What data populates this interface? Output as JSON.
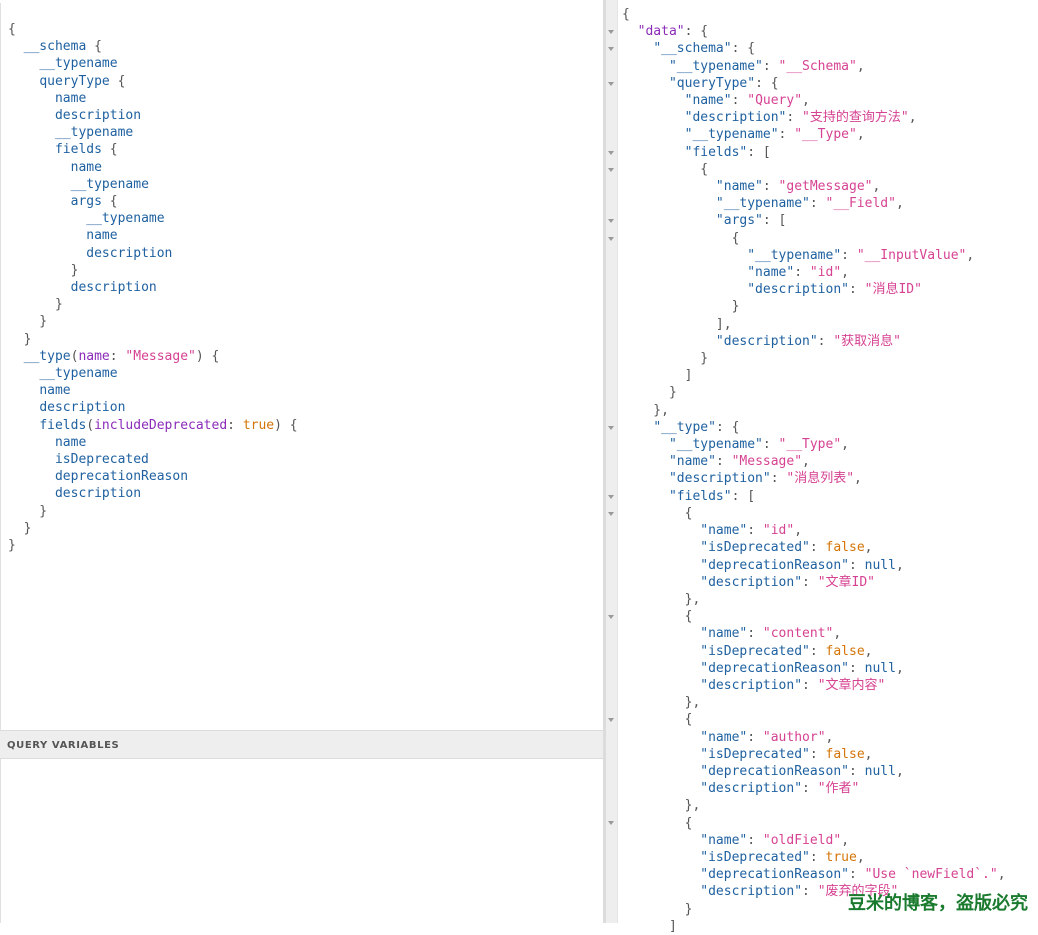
{
  "query": {
    "lines": [
      [
        [
          "p",
          "{"
        ]
      ],
      [
        [
          "p",
          "  "
        ],
        [
          "k",
          "__schema"
        ],
        [
          "p",
          " {"
        ]
      ],
      [
        [
          "p",
          "    "
        ],
        [
          "k",
          "__typename"
        ]
      ],
      [
        [
          "p",
          "    "
        ],
        [
          "k",
          "queryType"
        ],
        [
          "p",
          " {"
        ]
      ],
      [
        [
          "p",
          "      "
        ],
        [
          "k",
          "name"
        ]
      ],
      [
        [
          "p",
          "      "
        ],
        [
          "k",
          "description"
        ]
      ],
      [
        [
          "p",
          "      "
        ],
        [
          "k",
          "__typename"
        ]
      ],
      [
        [
          "p",
          "      "
        ],
        [
          "k",
          "fields"
        ],
        [
          "p",
          " {"
        ]
      ],
      [
        [
          "p",
          "        "
        ],
        [
          "k",
          "name"
        ]
      ],
      [
        [
          "p",
          "        "
        ],
        [
          "k",
          "__typename"
        ]
      ],
      [
        [
          "p",
          "        "
        ],
        [
          "k",
          "args"
        ],
        [
          "p",
          " {"
        ]
      ],
      [
        [
          "p",
          "          "
        ],
        [
          "k",
          "__typename"
        ]
      ],
      [
        [
          "p",
          "          "
        ],
        [
          "k",
          "name"
        ]
      ],
      [
        [
          "p",
          "          "
        ],
        [
          "k",
          "description"
        ]
      ],
      [
        [
          "p",
          "        }"
        ]
      ],
      [
        [
          "p",
          "        "
        ],
        [
          "k",
          "description"
        ]
      ],
      [
        [
          "p",
          "      }"
        ]
      ],
      [
        [
          "p",
          "    }"
        ]
      ],
      [
        [
          "p",
          "  }"
        ]
      ],
      [
        [
          "p",
          "  "
        ],
        [
          "k",
          "__type"
        ],
        [
          "p",
          "("
        ],
        [
          "a",
          "name"
        ],
        [
          "p",
          ": "
        ],
        [
          "s",
          "\"Message\""
        ],
        [
          "p",
          ") {"
        ]
      ],
      [
        [
          "p",
          "    "
        ],
        [
          "k",
          "__typename"
        ]
      ],
      [
        [
          "p",
          "    "
        ],
        [
          "k",
          "name"
        ]
      ],
      [
        [
          "p",
          "    "
        ],
        [
          "k",
          "description"
        ]
      ],
      [
        [
          "p",
          "    "
        ],
        [
          "k",
          "fields"
        ],
        [
          "p",
          "("
        ],
        [
          "a",
          "includeDeprecated"
        ],
        [
          "p",
          ": "
        ],
        [
          "b",
          "true"
        ],
        [
          "p",
          ") {"
        ]
      ],
      [
        [
          "p",
          "      "
        ],
        [
          "k",
          "name"
        ]
      ],
      [
        [
          "p",
          "      "
        ],
        [
          "k",
          "isDeprecated"
        ]
      ],
      [
        [
          "p",
          "      "
        ],
        [
          "k",
          "deprecationReason"
        ]
      ],
      [
        [
          "p",
          "      "
        ],
        [
          "k",
          "description"
        ]
      ],
      [
        [
          "p",
          "    }"
        ]
      ],
      [
        [
          "p",
          "  }"
        ]
      ],
      [
        [
          "p",
          "}"
        ]
      ]
    ]
  },
  "variables": {
    "title": "QUERY VARIABLES"
  },
  "result": {
    "lines": [
      [
        [
          "p",
          "{"
        ]
      ],
      [
        [
          "p",
          "  "
        ],
        [
          "a",
          "\"data\""
        ],
        [
          "p",
          ": {"
        ]
      ],
      [
        [
          "p",
          "    "
        ],
        [
          "k",
          "\"__schema\""
        ],
        [
          "p",
          ": {"
        ]
      ],
      [
        [
          "p",
          "      "
        ],
        [
          "k",
          "\"__typename\""
        ],
        [
          "p",
          ": "
        ],
        [
          "s",
          "\"__Schema\""
        ],
        [
          "p",
          ","
        ]
      ],
      [
        [
          "p",
          "      "
        ],
        [
          "k",
          "\"queryType\""
        ],
        [
          "p",
          ": {"
        ]
      ],
      [
        [
          "p",
          "        "
        ],
        [
          "k",
          "\"name\""
        ],
        [
          "p",
          ": "
        ],
        [
          "s",
          "\"Query\""
        ],
        [
          "p",
          ","
        ]
      ],
      [
        [
          "p",
          "        "
        ],
        [
          "k",
          "\"description\""
        ],
        [
          "p",
          ": "
        ],
        [
          "s",
          "\"支持的查询方法\""
        ],
        [
          "p",
          ","
        ]
      ],
      [
        [
          "p",
          "        "
        ],
        [
          "k",
          "\"__typename\""
        ],
        [
          "p",
          ": "
        ],
        [
          "s",
          "\"__Type\""
        ],
        [
          "p",
          ","
        ]
      ],
      [
        [
          "p",
          "        "
        ],
        [
          "k",
          "\"fields\""
        ],
        [
          "p",
          ": ["
        ]
      ],
      [
        [
          "p",
          "          {"
        ]
      ],
      [
        [
          "p",
          "            "
        ],
        [
          "k",
          "\"name\""
        ],
        [
          "p",
          ": "
        ],
        [
          "s",
          "\"getMessage\""
        ],
        [
          "p",
          ","
        ]
      ],
      [
        [
          "p",
          "            "
        ],
        [
          "k",
          "\"__typename\""
        ],
        [
          "p",
          ": "
        ],
        [
          "s",
          "\"__Field\""
        ],
        [
          "p",
          ","
        ]
      ],
      [
        [
          "p",
          "            "
        ],
        [
          "k",
          "\"args\""
        ],
        [
          "p",
          ": ["
        ]
      ],
      [
        [
          "p",
          "              {"
        ]
      ],
      [
        [
          "p",
          "                "
        ],
        [
          "k",
          "\"__typename\""
        ],
        [
          "p",
          ": "
        ],
        [
          "s",
          "\"__InputValue\""
        ],
        [
          "p",
          ","
        ]
      ],
      [
        [
          "p",
          "                "
        ],
        [
          "k",
          "\"name\""
        ],
        [
          "p",
          ": "
        ],
        [
          "s",
          "\"id\""
        ],
        [
          "p",
          ","
        ]
      ],
      [
        [
          "p",
          "                "
        ],
        [
          "k",
          "\"description\""
        ],
        [
          "p",
          ": "
        ],
        [
          "s",
          "\"消息ID\""
        ]
      ],
      [
        [
          "p",
          "              }"
        ]
      ],
      [
        [
          "p",
          "            ],"
        ]
      ],
      [
        [
          "p",
          "            "
        ],
        [
          "k",
          "\"description\""
        ],
        [
          "p",
          ": "
        ],
        [
          "s",
          "\"获取消息\""
        ]
      ],
      [
        [
          "p",
          "          }"
        ]
      ],
      [
        [
          "p",
          "        ]"
        ]
      ],
      [
        [
          "p",
          "      }"
        ]
      ],
      [
        [
          "p",
          "    },"
        ]
      ],
      [
        [
          "p",
          "    "
        ],
        [
          "k",
          "\"__type\""
        ],
        [
          "p",
          ": {"
        ]
      ],
      [
        [
          "p",
          "      "
        ],
        [
          "k",
          "\"__typename\""
        ],
        [
          "p",
          ": "
        ],
        [
          "s",
          "\"__Type\""
        ],
        [
          "p",
          ","
        ]
      ],
      [
        [
          "p",
          "      "
        ],
        [
          "k",
          "\"name\""
        ],
        [
          "p",
          ": "
        ],
        [
          "s",
          "\"Message\""
        ],
        [
          "p",
          ","
        ]
      ],
      [
        [
          "p",
          "      "
        ],
        [
          "k",
          "\"description\""
        ],
        [
          "p",
          ": "
        ],
        [
          "s",
          "\"消息列表\""
        ],
        [
          "p",
          ","
        ]
      ],
      [
        [
          "p",
          "      "
        ],
        [
          "k",
          "\"fields\""
        ],
        [
          "p",
          ": ["
        ]
      ],
      [
        [
          "p",
          "        {"
        ]
      ],
      [
        [
          "p",
          "          "
        ],
        [
          "k",
          "\"name\""
        ],
        [
          "p",
          ": "
        ],
        [
          "s",
          "\"id\""
        ],
        [
          "p",
          ","
        ]
      ],
      [
        [
          "p",
          "          "
        ],
        [
          "k",
          "\"isDeprecated\""
        ],
        [
          "p",
          ": "
        ],
        [
          "b",
          "false"
        ],
        [
          "p",
          ","
        ]
      ],
      [
        [
          "p",
          "          "
        ],
        [
          "k",
          "\"deprecationReason\""
        ],
        [
          "p",
          ": "
        ],
        [
          "n",
          "null"
        ],
        [
          "p",
          ","
        ]
      ],
      [
        [
          "p",
          "          "
        ],
        [
          "k",
          "\"description\""
        ],
        [
          "p",
          ": "
        ],
        [
          "s",
          "\"文章ID\""
        ]
      ],
      [
        [
          "p",
          "        },"
        ]
      ],
      [
        [
          "p",
          "        {"
        ]
      ],
      [
        [
          "p",
          "          "
        ],
        [
          "k",
          "\"name\""
        ],
        [
          "p",
          ": "
        ],
        [
          "s",
          "\"content\""
        ],
        [
          "p",
          ","
        ]
      ],
      [
        [
          "p",
          "          "
        ],
        [
          "k",
          "\"isDeprecated\""
        ],
        [
          "p",
          ": "
        ],
        [
          "b",
          "false"
        ],
        [
          "p",
          ","
        ]
      ],
      [
        [
          "p",
          "          "
        ],
        [
          "k",
          "\"deprecationReason\""
        ],
        [
          "p",
          ": "
        ],
        [
          "n",
          "null"
        ],
        [
          "p",
          ","
        ]
      ],
      [
        [
          "p",
          "          "
        ],
        [
          "k",
          "\"description\""
        ],
        [
          "p",
          ": "
        ],
        [
          "s",
          "\"文章内容\""
        ]
      ],
      [
        [
          "p",
          "        },"
        ]
      ],
      [
        [
          "p",
          "        {"
        ]
      ],
      [
        [
          "p",
          "          "
        ],
        [
          "k",
          "\"name\""
        ],
        [
          "p",
          ": "
        ],
        [
          "s",
          "\"author\""
        ],
        [
          "p",
          ","
        ]
      ],
      [
        [
          "p",
          "          "
        ],
        [
          "k",
          "\"isDeprecated\""
        ],
        [
          "p",
          ": "
        ],
        [
          "b",
          "false"
        ],
        [
          "p",
          ","
        ]
      ],
      [
        [
          "p",
          "          "
        ],
        [
          "k",
          "\"deprecationReason\""
        ],
        [
          "p",
          ": "
        ],
        [
          "n",
          "null"
        ],
        [
          "p",
          ","
        ]
      ],
      [
        [
          "p",
          "          "
        ],
        [
          "k",
          "\"description\""
        ],
        [
          "p",
          ": "
        ],
        [
          "s",
          "\"作者\""
        ]
      ],
      [
        [
          "p",
          "        },"
        ]
      ],
      [
        [
          "p",
          "        {"
        ]
      ],
      [
        [
          "p",
          "          "
        ],
        [
          "k",
          "\"name\""
        ],
        [
          "p",
          ": "
        ],
        [
          "s",
          "\"oldField\""
        ],
        [
          "p",
          ","
        ]
      ],
      [
        [
          "p",
          "          "
        ],
        [
          "k",
          "\"isDeprecated\""
        ],
        [
          "p",
          ": "
        ],
        [
          "b",
          "true"
        ],
        [
          "p",
          ","
        ]
      ],
      [
        [
          "p",
          "          "
        ],
        [
          "k",
          "\"deprecationReason\""
        ],
        [
          "p",
          ": "
        ],
        [
          "s",
          "\"Use `newField`.\""
        ],
        [
          "p",
          ","
        ]
      ],
      [
        [
          "p",
          "          "
        ],
        [
          "k",
          "\"description\""
        ],
        [
          "p",
          ": "
        ],
        [
          "s",
          "\"废弃的字段\""
        ]
      ],
      [
        [
          "p",
          "        }"
        ]
      ],
      [
        [
          "p",
          "      ]"
        ]
      ]
    ]
  },
  "watermark": "豆米的博客，盗版必究"
}
